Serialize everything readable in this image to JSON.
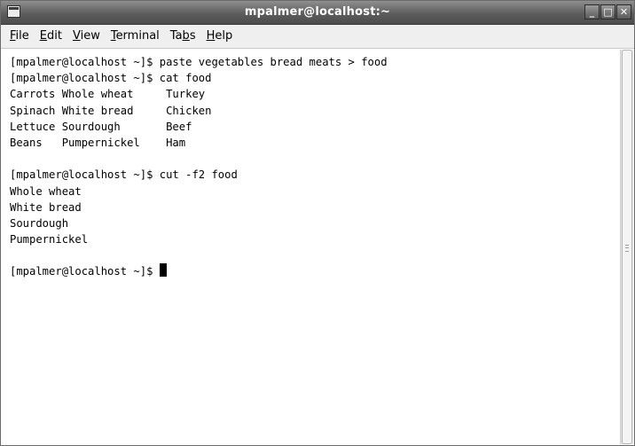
{
  "window": {
    "title": "mpalmer@localhost:~",
    "buttons": {
      "minimize": "_",
      "maximize": "□",
      "close": "✕"
    }
  },
  "menu": [
    {
      "pre": "",
      "key": "F",
      "post": "ile",
      "name": "menu-file"
    },
    {
      "pre": "",
      "key": "E",
      "post": "dit",
      "name": "menu-edit"
    },
    {
      "pre": "",
      "key": "V",
      "post": "iew",
      "name": "menu-view"
    },
    {
      "pre": "",
      "key": "T",
      "post": "erminal",
      "name": "menu-terminal"
    },
    {
      "pre": "Ta",
      "key": "b",
      "post": "s",
      "name": "menu-tabs"
    },
    {
      "pre": "",
      "key": "H",
      "post": "elp",
      "name": "menu-help"
    }
  ],
  "terminal": {
    "lines": [
      "[mpalmer@localhost ~]$ paste vegetables bread meats > food",
      "[mpalmer@localhost ~]$ cat food",
      "Carrots Whole wheat     Turkey",
      "Spinach White bread     Chicken",
      "Lettuce Sourdough       Beef",
      "Beans   Pumpernickel    Ham",
      "",
      "[mpalmer@localhost ~]$ cut -f2 food",
      "Whole wheat",
      "White bread",
      "Sourdough",
      "Pumpernickel",
      ""
    ],
    "prompt": "[mpalmer@localhost ~]$ "
  }
}
